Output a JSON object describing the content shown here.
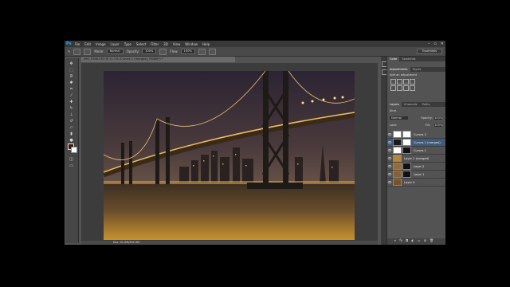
{
  "menubar": {
    "logo": "Ps",
    "items": [
      "File",
      "Edit",
      "Image",
      "Layer",
      "Type",
      "Select",
      "Filter",
      "3D",
      "View",
      "Window",
      "Help"
    ],
    "window_controls": [
      "–",
      "▫",
      "✕"
    ]
  },
  "options": {
    "mode_label": "Mode:",
    "mode_value": "Normal",
    "opacity_label": "Opacity:",
    "opacity_value": "100%",
    "flow_label": "Flow:",
    "flow_value": "100%",
    "workspace": "Essentials"
  },
  "document": {
    "tab_title": "IMG_0788.CR2 @ 11.1% (Curves 1 (merged), RGB/8*) *",
    "status": "Doc: 51.0M/301.9M"
  },
  "panels": {
    "top_tabs": [
      "Color",
      "Swatches"
    ],
    "adjust_tabs": [
      "Adjustments",
      "Styles"
    ],
    "adjust_hint": "Add an adjustment",
    "layers_tabs": [
      "Layers",
      "Channels",
      "Paths"
    ],
    "kind_label": "Kind",
    "blend_mode": "Normal",
    "opacity_label": "Opacity:",
    "opacity_value": "100%",
    "lock_label": "Lock:",
    "fill_label": "Fill:",
    "fill_value": "100%"
  },
  "layers": [
    {
      "name": "Curves 2",
      "selected": false,
      "thumb": "#ffffff",
      "mask": "#ffffff"
    },
    {
      "name": "Curves 1 (merged)",
      "selected": true,
      "thumb": "#1a1a1a",
      "mask": "#ffffff"
    },
    {
      "name": "Curves 1",
      "selected": false,
      "thumb": "#ffffff",
      "mask": "#111111"
    },
    {
      "name": "Layer 2 (merged)",
      "selected": false,
      "thumb": "#b8843a",
      "mask": ""
    },
    {
      "name": "Layer 2",
      "selected": false,
      "thumb": "#9a6a30",
      "mask": "#111111"
    },
    {
      "name": "Layer 1",
      "selected": false,
      "thumb": "#8a6030",
      "mask": "#111111"
    },
    {
      "name": "Layer 0",
      "selected": false,
      "thumb": "#7a5226",
      "mask": ""
    }
  ],
  "colors": {
    "accent": "#2fa3ff",
    "foreground": "#3a1a08",
    "background": "#ffffff",
    "selected_layer": "#3f5a7a"
  }
}
